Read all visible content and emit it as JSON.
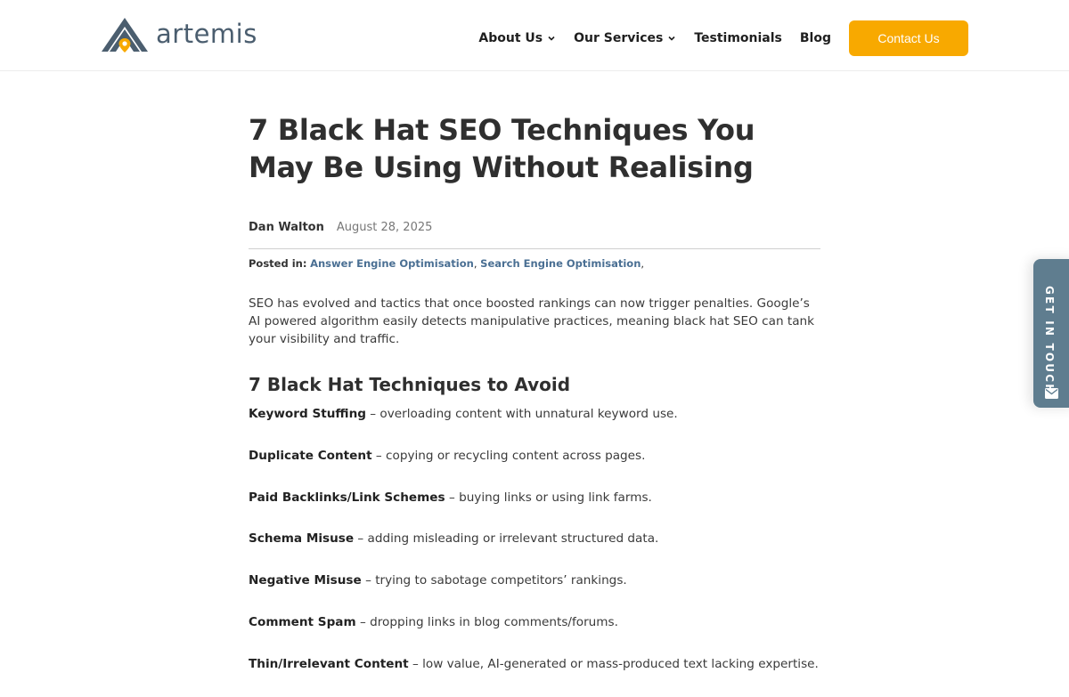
{
  "brand": {
    "name": "artemis"
  },
  "nav": {
    "items": [
      {
        "label": "About Us",
        "has_dropdown": true
      },
      {
        "label": "Our Services",
        "has_dropdown": true
      },
      {
        "label": "Testimonials",
        "has_dropdown": false
      },
      {
        "label": "Blog",
        "has_dropdown": false
      }
    ],
    "contact_label": "Contact Us"
  },
  "article": {
    "title": "7 Black Hat SEO Techniques You May Be Using Without Realising",
    "author": "Dan Walton",
    "date": "August 28, 2025",
    "posted_in_label": "Posted in:",
    "categories": [
      "Answer Engine Optimisation",
      "Search Engine Optimisation"
    ],
    "intro": "SEO has evolved and tactics that once boosted rankings can now trigger penalties. Google’s AI powered algorithm easily detects  manipulative practices, meaning black hat SEO can tank your visibility and traffic.",
    "subheading": "7 Black Hat Techniques to Avoid",
    "techniques": [
      {
        "term": "Keyword Stuffing",
        "desc": " – overloading content with unnatural keyword use."
      },
      {
        "term": "Duplicate Content",
        "desc": " – copying or recycling content across pages."
      },
      {
        "term": "Paid Backlinks/Link Schemes",
        "desc": " – buying links or using link farms."
      },
      {
        "term": "Schema Misuse",
        "desc": " – adding misleading or irrelevant structured data."
      },
      {
        "term": "Negative Misuse",
        "desc": " – trying to sabotage competitors’ rankings."
      },
      {
        "term": "Comment Spam",
        "desc": " – dropping links in blog comments/forums."
      },
      {
        "term": "Thin/Irrelevant Content",
        "desc": " – low value, AI-generated or mass-produced text lacking expertise."
      }
    ]
  },
  "side_tab": {
    "label": "GET IN TOUCH",
    "icon": "envelope-icon"
  },
  "colors": {
    "accent": "#f8a900",
    "link": "#4a6f93",
    "side_tab": "#5f7d8f",
    "logo_text": "#4b5e6f"
  }
}
